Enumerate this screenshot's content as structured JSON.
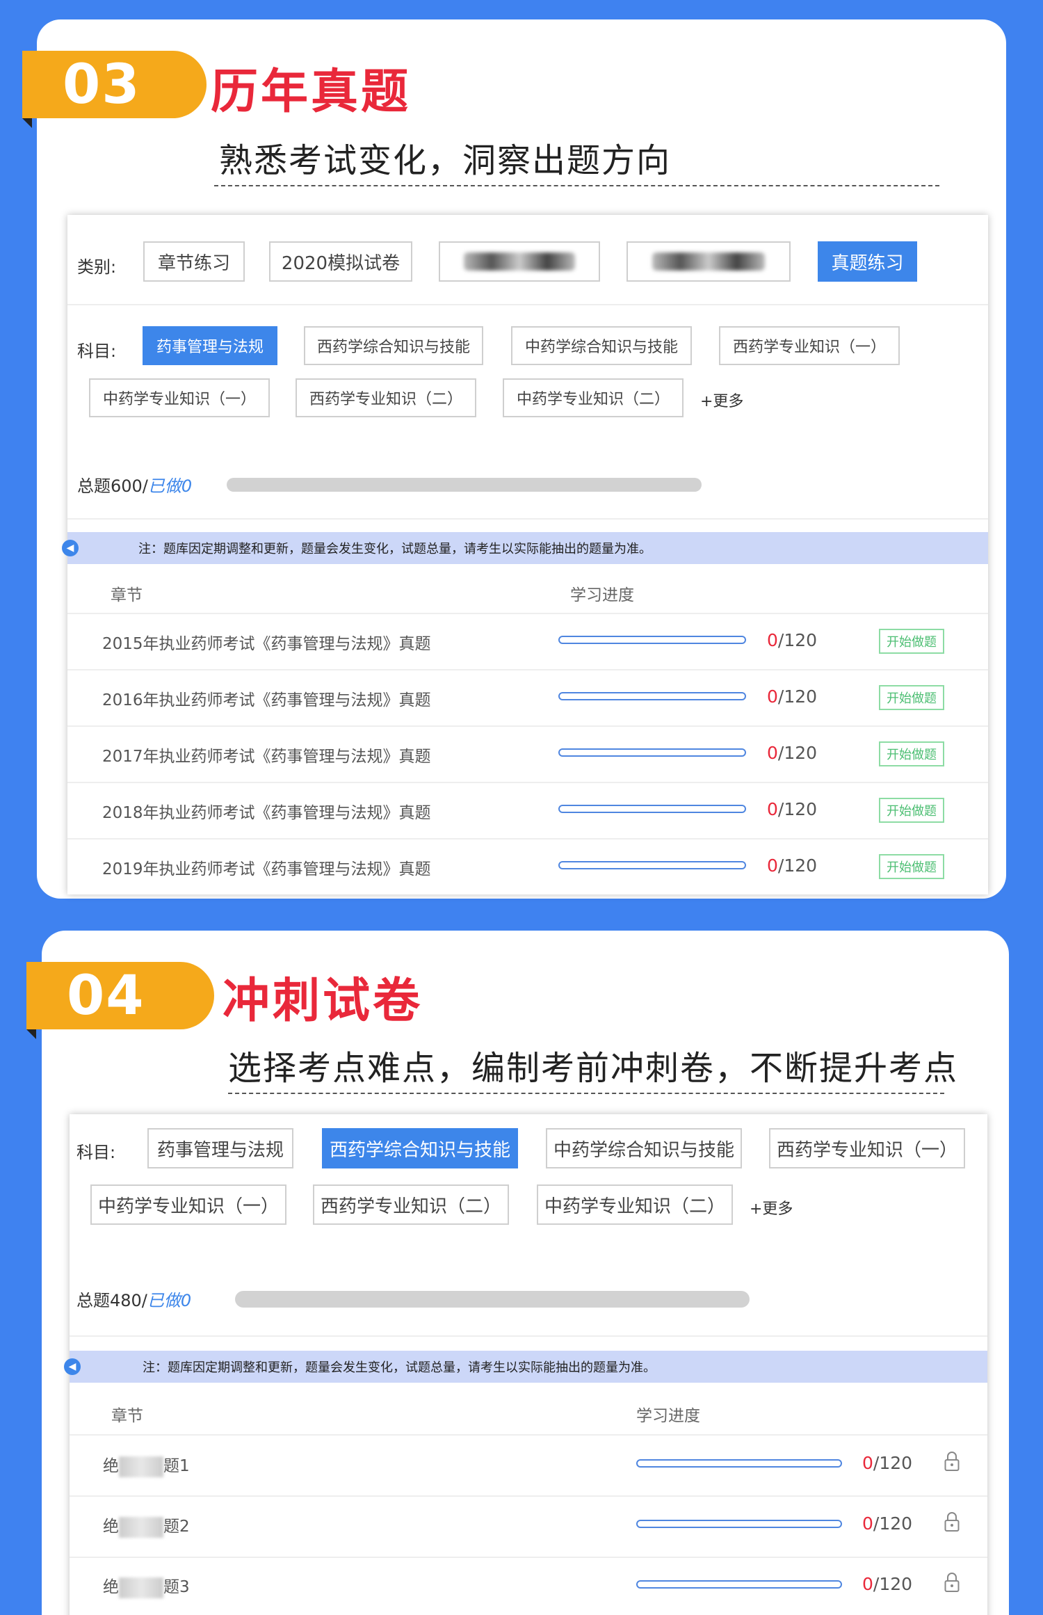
{
  "section1": {
    "number": "03",
    "title": "历年真题",
    "subtitle": "熟悉考试变化，洞察出题方向",
    "category_label": "类别:",
    "categories": [
      "章节练习",
      "2020模拟试卷",
      "2020年押题试卷",
      "",
      "真题练习"
    ],
    "subject_label": "科目:",
    "subjects": [
      "药事管理与法规",
      "西药学综合知识与技能",
      "中药学综合知识与技能",
      "西药学专业知识（一）",
      "中药学专业知识（一）",
      "西药学专业知识（二）",
      "中药学专业知识（二）"
    ],
    "more": "+更多",
    "total_prefix": "总题600/",
    "total_done": "已做0",
    "notice": "注：题库因定期调整和更新，题量会发生变化，试题总量，请考生以实际能抽出的题量为准。",
    "col_chapter": "章节",
    "col_progress": "学习进度",
    "start_label": "开始做题",
    "rows": [
      {
        "name": "2015年执业药师考试《药事管理与法规》真题",
        "done": "0",
        "total": "/120",
        "progress": 0
      },
      {
        "name": "2016年执业药师考试《药事管理与法规》真题",
        "done": "0",
        "total": "/120",
        "progress": 0
      },
      {
        "name": "2017年执业药师考试《药事管理与法规》真题",
        "done": "0",
        "total": "/120",
        "progress": 0
      },
      {
        "name": "2018年执业药师考试《药事管理与法规》真题",
        "done": "0",
        "total": "/120",
        "progress": 0
      },
      {
        "name": "2019年执业药师考试《药事管理与法规》真题",
        "done": "0",
        "total": "/120",
        "progress": 0
      }
    ]
  },
  "section2": {
    "number": "04",
    "title": "冲刺试卷",
    "subtitle": "选择考点难点，编制考前冲刺卷，不断提升考点",
    "subject_label": "科目:",
    "subjects": [
      "药事管理与法规",
      "西药学综合知识与技能",
      "中药学综合知识与技能",
      "西药学专业知识（一）",
      "中药学专业知识（一）",
      "西药学专业知识（二）",
      "中药学专业知识（二）"
    ],
    "more": "+更多",
    "total_prefix": "总题480/",
    "total_done": "已做0",
    "notice": "注：题库因定期调整和更新，题量会发生变化，试题总量，请考生以实际能抽出的题量为准。",
    "col_chapter": "章节",
    "col_progress": "学习进度",
    "rows": [
      {
        "prefix": "绝",
        "suffix": "题1",
        "done": "0",
        "total": "/120",
        "progress": 0
      },
      {
        "prefix": "绝",
        "suffix": "题2",
        "done": "0",
        "total": "/120",
        "progress": 0
      },
      {
        "prefix": "绝",
        "suffix": "题3",
        "done": "0",
        "total": "/120",
        "progress": 0
      }
    ]
  },
  "colors": {
    "background": "#3f82f0",
    "badge": "#f5a91b",
    "title_red": "#e9283a",
    "active_blue": "#3d86ea",
    "start_green": "#4cbe72"
  },
  "icons": {
    "speaker": "speaker-icon",
    "lock": "lock-icon"
  }
}
